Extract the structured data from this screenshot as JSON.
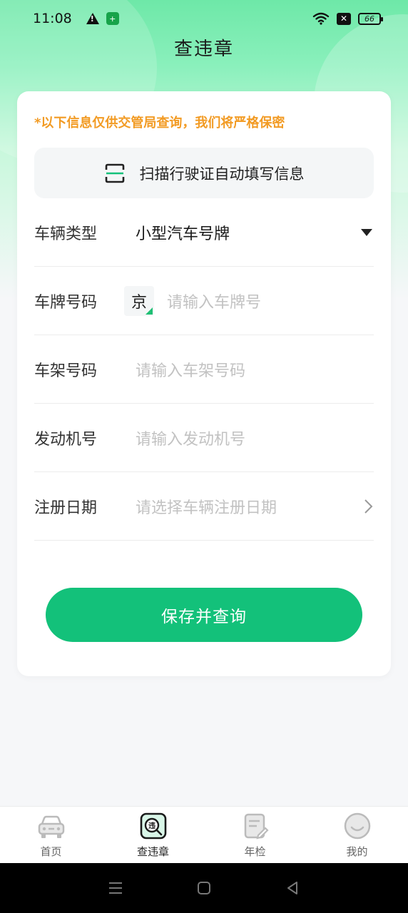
{
  "status": {
    "time": "11:08",
    "battery": "66",
    "shield_glyph": "+",
    "x_glyph": "✕"
  },
  "title": "查违章",
  "notice": "*以下信息仅供交管局查询，我们将严格保密",
  "scan": {
    "label": "扫描行驶证自动填写信息"
  },
  "form": {
    "vehicle_type": {
      "label": "车辆类型",
      "value": "小型汽车号牌"
    },
    "plate": {
      "label": "车牌号码",
      "prefix": "京",
      "placeholder": "请输入车牌号"
    },
    "vin": {
      "label": "车架号码",
      "placeholder": "请输入车架号码"
    },
    "engine": {
      "label": "发动机号",
      "placeholder": "请输入发动机号"
    },
    "reg_date": {
      "label": "注册日期",
      "placeholder": "请选择车辆注册日期"
    }
  },
  "submit_label": "保存并查询",
  "tabs": [
    {
      "label": "首页",
      "icon": "car-icon"
    },
    {
      "label": "查违章",
      "icon": "violation-search-icon",
      "badge": "违"
    },
    {
      "label": "年检",
      "icon": "inspection-icon"
    },
    {
      "label": "我的",
      "icon": "profile-icon"
    }
  ],
  "colors": {
    "accent": "#13c17a",
    "notice": "#f29b24",
    "header_gradient_top": "#6ee8a8"
  }
}
